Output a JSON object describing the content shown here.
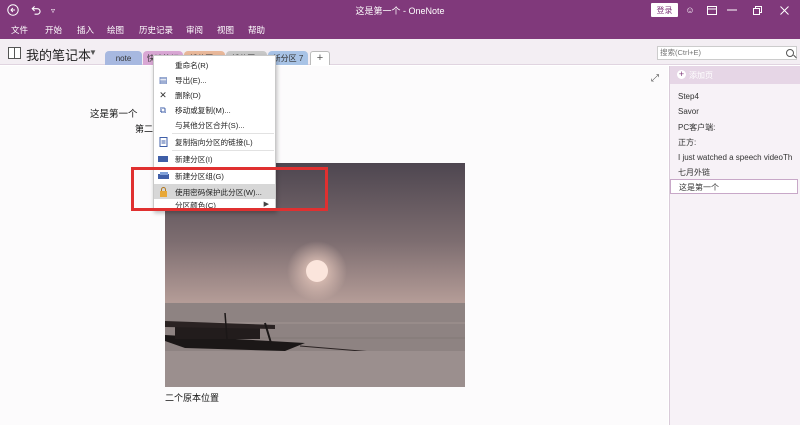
{
  "window": {
    "title": "这是第一个 - OneNote",
    "login_label": "登录",
    "colors": {
      "accent": "#80397b",
      "highlight_box": "#e03030"
    }
  },
  "titlebar_icons": [
    "back-icon",
    "undo-icon",
    "quick-access-dropdown-icon",
    "help-icon",
    "ribbon-display-icon",
    "minimize-icon",
    "maximize-icon",
    "close-icon"
  ],
  "menu": {
    "items": [
      "文件",
      "开始",
      "插入",
      "绘图",
      "历史记录",
      "审阅",
      "视图",
      "帮助"
    ]
  },
  "notebook": {
    "title": "我的笔记本",
    "tabs": [
      {
        "label": "note",
        "color": "#a7b8e0"
      },
      {
        "label": "快速笔记",
        "color": "#d9a7d4"
      },
      {
        "label": "新分区 3",
        "color": "#e9b89a"
      },
      {
        "label": "新分区 4",
        "color": "#c9c9c9"
      },
      {
        "label": "新分区 7",
        "color": "#a8c3e6"
      }
    ],
    "add_tab": "+"
  },
  "search": {
    "placeholder": "搜索(Ctrl+E)"
  },
  "page": {
    "text1": "这是第一个",
    "text2": "第二",
    "caption": "二个原本位置"
  },
  "context_menu": {
    "items": [
      {
        "label": "重命名(R)",
        "icon": "rename-icon",
        "glyph": ""
      },
      {
        "label": "导出(E)...",
        "icon": "export-icon",
        "glyph": "▤"
      },
      {
        "label": "删除(D)",
        "icon": "delete-icon",
        "glyph": "✕"
      },
      {
        "label": "移动或复制(M)...",
        "icon": "move-copy-icon",
        "glyph": "⧉"
      },
      {
        "label": "与其他分区合并(S)...",
        "icon": "merge-icon",
        "glyph": ""
      },
      {
        "label": "复制指向分区的链接(L)",
        "icon": "link-icon",
        "glyph": "🔗"
      },
      {
        "label": "新建分区(I)",
        "icon": "new-section-icon",
        "glyph": "▬"
      },
      {
        "label": "新建分区组(G)",
        "icon": "new-section-group-icon",
        "glyph": "▰"
      },
      {
        "label": "使用密码保护此分区(W)...",
        "icon": "password-protect-icon",
        "glyph": "🔒"
      },
      {
        "label": "分区颜色(C)",
        "icon": "section-color-icon",
        "glyph": ""
      }
    ]
  },
  "page_panel": {
    "add_page_label": "添加页",
    "pages": [
      "Step4",
      "Savor",
      "PC客户端:",
      "正方:",
      "I just watched a speech videoTh",
      "七月外链",
      "这是第一个"
    ]
  }
}
